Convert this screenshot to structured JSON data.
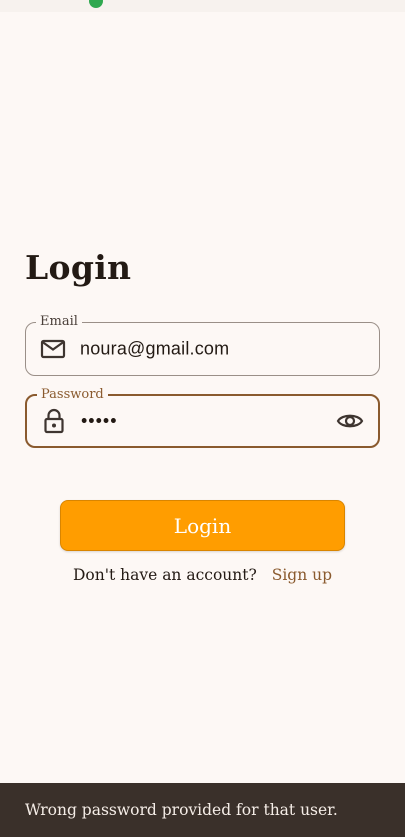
{
  "login_title": "Login",
  "email_field": {
    "label": "Email",
    "value": "noura@gmail.com",
    "icon": "mail-icon"
  },
  "password_field": {
    "label": "Password",
    "value": "•••••",
    "icon": "lock-icon",
    "toggle_icon": "eye-icon"
  },
  "login_button": {
    "label": "Login"
  },
  "signup": {
    "prompt": "Don't have an account?",
    "link": "Sign up"
  },
  "snackbar": {
    "message": "Wrong password provided for that user."
  },
  "colors": {
    "background": "#fdf8f5",
    "accent_brown": "#8a5a2e",
    "button_orange": "#ff9d00",
    "snackbar_bg": "#3a302a"
  }
}
